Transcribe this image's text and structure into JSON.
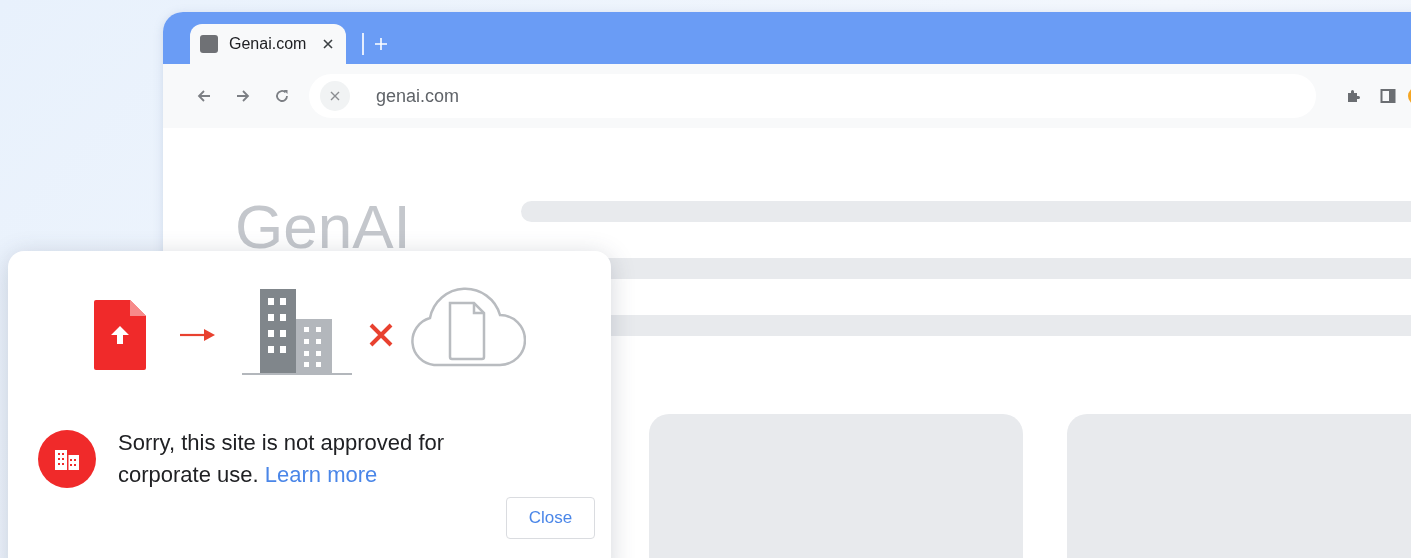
{
  "tabs": [
    {
      "title": "Genai.com"
    }
  ],
  "address_bar": {
    "value": "genai.com"
  },
  "page": {
    "logo": "GenAI"
  },
  "dialog": {
    "message": "Sorry, this site is not approved for corporate use.",
    "link": "Learn more",
    "button": "Close"
  }
}
